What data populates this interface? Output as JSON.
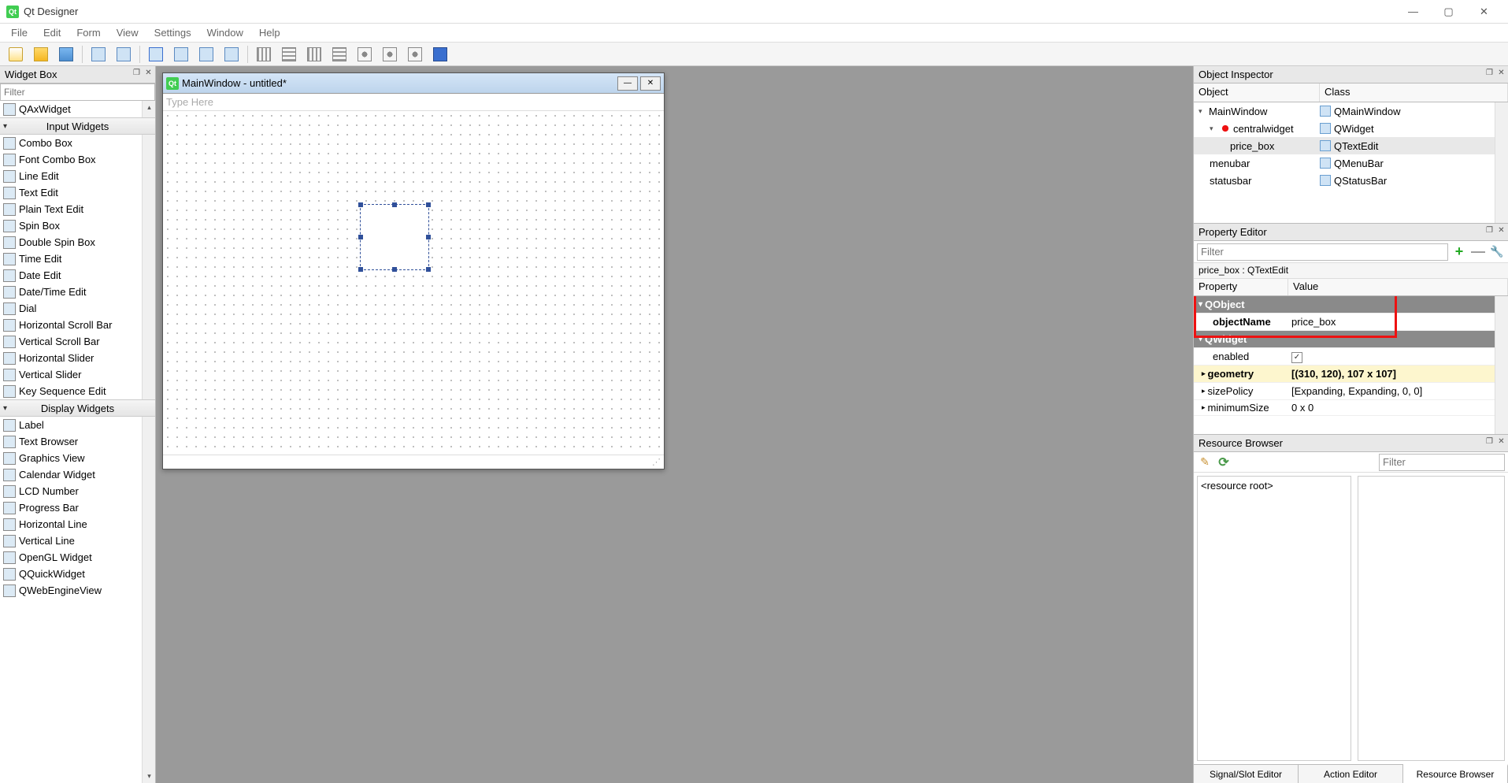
{
  "titlebar": {
    "app_name": "Qt Designer"
  },
  "menubar": [
    "File",
    "Edit",
    "Form",
    "View",
    "Settings",
    "Window",
    "Help"
  ],
  "widget_box": {
    "title": "Widget Box",
    "filter_placeholder": "Filter",
    "items_top": [
      {
        "label": "QAxWidget",
        "icon": "ax-widget-icon"
      }
    ],
    "cat_input": "Input Widgets",
    "items_input": [
      {
        "label": "Combo Box",
        "icon": "combo-icon"
      },
      {
        "label": "Font Combo Box",
        "icon": "font-combo-icon"
      },
      {
        "label": "Line Edit",
        "icon": "line-edit-icon"
      },
      {
        "label": "Text Edit",
        "icon": "text-edit-icon"
      },
      {
        "label": "Plain Text Edit",
        "icon": "plain-text-icon"
      },
      {
        "label": "Spin Box",
        "icon": "spin-box-icon"
      },
      {
        "label": "Double Spin Box",
        "icon": "double-spin-icon"
      },
      {
        "label": "Time Edit",
        "icon": "time-edit-icon"
      },
      {
        "label": "Date Edit",
        "icon": "date-edit-icon"
      },
      {
        "label": "Date/Time Edit",
        "icon": "datetime-edit-icon"
      },
      {
        "label": "Dial",
        "icon": "dial-icon"
      },
      {
        "label": "Horizontal Scroll Bar",
        "icon": "hscroll-icon"
      },
      {
        "label": "Vertical Scroll Bar",
        "icon": "vscroll-icon"
      },
      {
        "label": "Horizontal Slider",
        "icon": "hslider-icon"
      },
      {
        "label": "Vertical Slider",
        "icon": "vslider-icon"
      },
      {
        "label": "Key Sequence Edit",
        "icon": "keyseq-icon"
      }
    ],
    "cat_display": "Display Widgets",
    "items_display": [
      {
        "label": "Label",
        "icon": "label-icon"
      },
      {
        "label": "Text Browser",
        "icon": "text-browser-icon"
      },
      {
        "label": "Graphics View",
        "icon": "graphics-view-icon"
      },
      {
        "label": "Calendar Widget",
        "icon": "calendar-icon"
      },
      {
        "label": "LCD Number",
        "icon": "lcd-icon"
      },
      {
        "label": "Progress Bar",
        "icon": "progress-icon"
      },
      {
        "label": "Horizontal Line",
        "icon": "hline-icon"
      },
      {
        "label": "Vertical Line",
        "icon": "vline-icon"
      },
      {
        "label": "OpenGL Widget",
        "icon": "opengl-icon"
      },
      {
        "label": "QQuickWidget",
        "icon": "qquick-icon"
      },
      {
        "label": "QWebEngineView",
        "icon": "webview-icon"
      }
    ]
  },
  "form": {
    "title": "MainWindow - untitled*",
    "menu_placeholder": "Type Here"
  },
  "object_inspector": {
    "title": "Object Inspector",
    "col_object": "Object",
    "col_class": "Class",
    "rows": [
      {
        "obj": "MainWindow",
        "cls": "QMainWindow",
        "indent": 0,
        "exp": "v"
      },
      {
        "obj": "centralwidget",
        "cls": "QWidget",
        "indent": 1,
        "exp": "v",
        "reddot": true
      },
      {
        "obj": "price_box",
        "cls": "QTextEdit",
        "indent": 2,
        "sel": true
      },
      {
        "obj": "menubar",
        "cls": "QMenuBar",
        "indent": 1
      },
      {
        "obj": "statusbar",
        "cls": "QStatusBar",
        "indent": 1
      }
    ]
  },
  "property_editor": {
    "title": "Property Editor",
    "filter_placeholder": "Filter",
    "object_path": "price_box : QTextEdit",
    "col_property": "Property",
    "col_value": "Value",
    "groups": [
      {
        "name": "QObject",
        "rows": [
          {
            "prop": "objectName",
            "val": "price_box",
            "bold": true
          }
        ]
      },
      {
        "name": "QWidget",
        "rows": [
          {
            "prop": "enabled",
            "val_check": true
          },
          {
            "prop": "geometry",
            "val": "[(310, 120), 107 x 107]",
            "hl": true,
            "exp": ">"
          },
          {
            "prop": "sizePolicy",
            "val": "[Expanding, Expanding, 0, 0]",
            "exp": ">"
          },
          {
            "prop": "minimumSize",
            "val": "0 x 0",
            "exp": ">",
            "half": true
          }
        ]
      }
    ]
  },
  "resource_browser": {
    "title": "Resource Browser",
    "filter_placeholder": "Filter",
    "root": "<resource root>"
  },
  "tabs": [
    "Signal/Slot Editor",
    "Action Editor",
    "Resource Browser"
  ]
}
